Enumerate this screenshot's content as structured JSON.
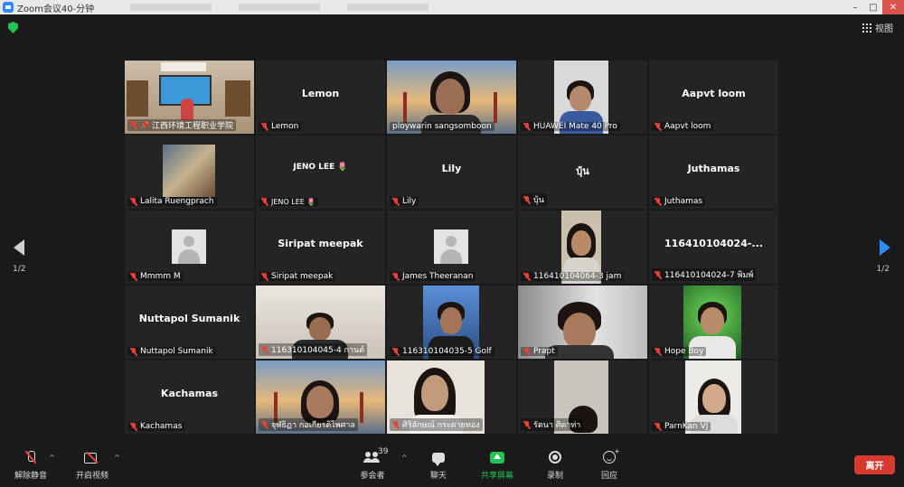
{
  "window": {
    "title": "Zoom会议40-分钟"
  },
  "header": {
    "view_label": "视图"
  },
  "colors": {
    "accent": "#2d8cff",
    "active_speaker": "#c9e86a",
    "share": "#23c552",
    "leave": "#d63a2f",
    "muted": "#e8413c"
  },
  "gallery": {
    "tiles": [
      {
        "name_label": "江西环境工程职业学院",
        "big_name": "",
        "pinned": true
      },
      {
        "name_label": "Lemon",
        "big_name": "Lemon"
      },
      {
        "name_label": "ploywarin sangsomboon",
        "big_name": "",
        "active": true
      },
      {
        "name_label": "HUAWEI Mate 40 Pro",
        "big_name": ""
      },
      {
        "name_label": "Aapvt loom",
        "big_name": "Aapvt loom"
      },
      {
        "name_label": "Lalita Ruengprach",
        "big_name": ""
      },
      {
        "name_label": "JENO LEE 🌷",
        "big_name": "JENO LEE 🌷"
      },
      {
        "name_label": "Lily",
        "big_name": "Lily"
      },
      {
        "name_label": "บุ้น",
        "big_name": "บุ้น"
      },
      {
        "name_label": "Juthamas",
        "big_name": "Juthamas"
      },
      {
        "name_label": "Mmmm M",
        "big_name": ""
      },
      {
        "name_label": "Siripat meepak",
        "big_name": "Siripat meepak"
      },
      {
        "name_label": "James Theeranan",
        "big_name": ""
      },
      {
        "name_label": "116410104064-3 jam",
        "big_name": ""
      },
      {
        "name_label": "116410104024-7 พิมพ์",
        "big_name": "116410104024-..."
      },
      {
        "name_label": "Nuttapol Sumanik",
        "big_name": "Nuttapol Sumanik"
      },
      {
        "name_label": "116310104045-4 กานต์",
        "big_name": ""
      },
      {
        "name_label": "116310104035-5 Golf",
        "big_name": ""
      },
      {
        "name_label": "Prapt",
        "big_name": ""
      },
      {
        "name_label": "Hope Boy",
        "big_name": ""
      },
      {
        "name_label": "Kachamas",
        "big_name": "Kachamas"
      },
      {
        "name_label": "จุฬธิฏา กอเกียรติไพศาล",
        "big_name": ""
      },
      {
        "name_label": "ศิริลักษณ์ กระตายทอง",
        "big_name": ""
      },
      {
        "name_label": "รัตนา ศิดาท่า",
        "big_name": ""
      },
      {
        "name_label": "ParnKan VJ",
        "big_name": ""
      }
    ]
  },
  "pagination": {
    "left": "1/2",
    "right": "1/2"
  },
  "toolbar": {
    "unmute_label": "解除静音",
    "start_video_label": "开启视频",
    "participants_label": "参会者",
    "participants_count": "39",
    "chat_label": "聊天",
    "share_label": "共享屏幕",
    "record_label": "录制",
    "reactions_label": "回应",
    "leave_label": "离开"
  }
}
